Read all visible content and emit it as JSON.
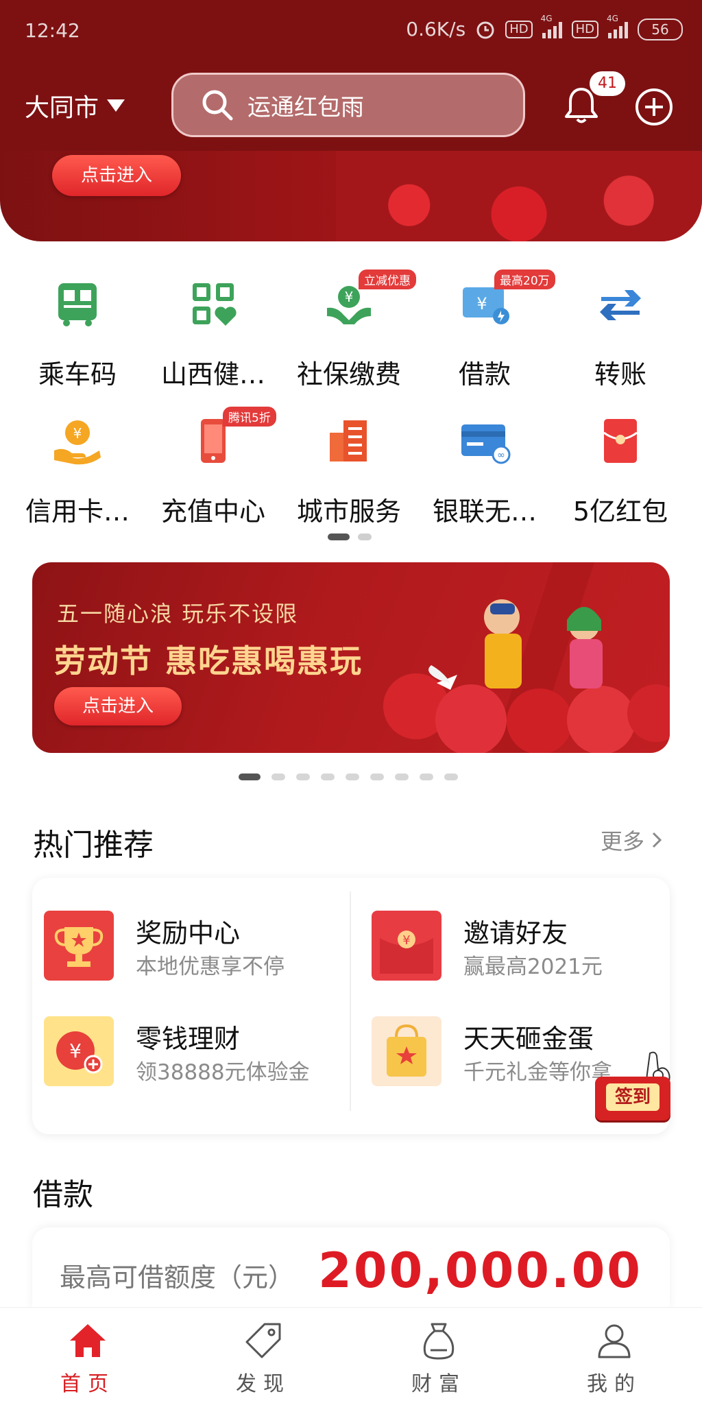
{
  "status_bar": {
    "time": "12:42",
    "network_speed": "0.6K/s",
    "hd_badge_1": "HD",
    "hd_badge_2": "HD",
    "signal_1_label": "4G",
    "signal_2_label": "4G",
    "battery": "56"
  },
  "header": {
    "city": "大同市",
    "search_text": "运通红包雨",
    "notification_count": "41",
    "bg_color": "#7d1112"
  },
  "top_banner": {
    "button_label": "点击进入"
  },
  "service_grid": {
    "row1": [
      {
        "label": "乘车码",
        "icon": "bus-qrcode-icon"
      },
      {
        "label": "山西健…",
        "icon": "health-code-icon"
      },
      {
        "label": "社保缴费",
        "icon": "social-security-icon",
        "tag": "立减优惠"
      },
      {
        "label": "借款",
        "icon": "loan-card-icon",
        "tag": "最高20万"
      },
      {
        "label": "转账",
        "icon": "transfer-arrows-icon"
      }
    ],
    "row2": [
      {
        "label": "信用卡…",
        "icon": "credit-card-hand-icon"
      },
      {
        "label": "充值中心",
        "icon": "phone-recharge-icon",
        "tag": "腾讯5折"
      },
      {
        "label": "城市服务",
        "icon": "city-building-icon"
      },
      {
        "label": "银联无…",
        "icon": "unionpay-card-icon"
      },
      {
        "label": "5亿红包",
        "icon": "red-envelope-icon"
      }
    ],
    "page_count": 2,
    "active_page": 1
  },
  "promo_banner": {
    "subtitle": "五一随心浪 玩乐不设限",
    "title": "劳动节 惠吃惠喝惠玩",
    "button_label": "点击进入",
    "dot_count": 9,
    "active_dot": 1
  },
  "hot": {
    "title": "热门推荐",
    "more_label": "更多",
    "items": [
      {
        "title": "奖励中心",
        "subtitle": "本地优惠享不停",
        "icon": "trophy-icon"
      },
      {
        "title": "邀请好友",
        "subtitle": "赢最高2021元",
        "icon": "red-packet-icon"
      },
      {
        "title": "零钱理财",
        "subtitle": "领38888元体验金",
        "icon": "yuan-coin-plus-icon"
      },
      {
        "title": "天天砸金蛋",
        "subtitle": "千元礼金等你拿",
        "icon": "gift-bag-icon"
      }
    ],
    "signin_label": "签到"
  },
  "loan": {
    "title": "借款",
    "label": "最高可借额度（元）",
    "amount": "200,000.00",
    "amount_color": "#de1b24"
  },
  "bottom_nav": [
    {
      "label": "首页",
      "icon": "home-icon",
      "active": true
    },
    {
      "label": "发现",
      "icon": "tag-icon",
      "active": false
    },
    {
      "label": "财富",
      "icon": "money-bag-icon",
      "active": false
    },
    {
      "label": "我的",
      "icon": "user-icon",
      "active": false
    }
  ]
}
